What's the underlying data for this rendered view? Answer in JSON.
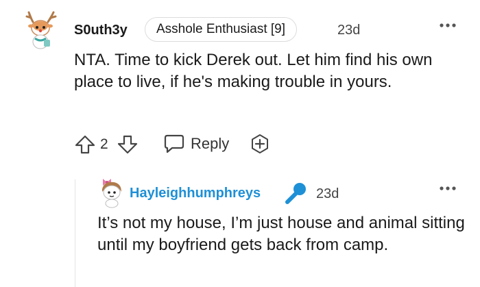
{
  "comment": {
    "username": "S0uth3y",
    "flair": "Asshole Enthusiast [9]",
    "time": "23d",
    "text": "NTA. Time to kick Derek out. Let him find his own place to live, if he's making trouble in yours.",
    "score": "2",
    "reply_label": "Reply",
    "avatar_icon": "reindeer-snoo-avatar-icon",
    "more_icon": "more-options-icon"
  },
  "reply": {
    "username": "Hayleighhumphreys",
    "time": "23d",
    "text": "It’s not my house, I’m just house and animal sitting until my boyfriend gets back from camp.",
    "badge_icon": "microphone-icon",
    "avatar_icon": "bow-snoo-avatar-icon",
    "username_color": "#1e90d6"
  },
  "colors": {
    "text": "#1a1a1b",
    "meta": "#444444",
    "flair_border": "#dcdcdc",
    "accent_blue": "#1e90d6",
    "thread_line": "#e3e3e3"
  }
}
